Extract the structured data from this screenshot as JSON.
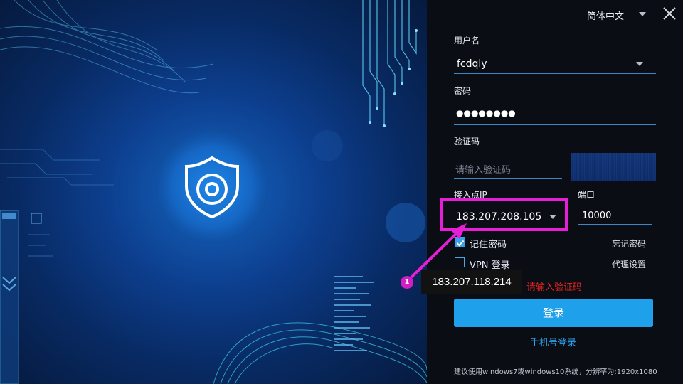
{
  "language": {
    "label": "简体中文"
  },
  "username": {
    "label": "用户名",
    "value": "fcdqly"
  },
  "password": {
    "label": "密码",
    "value": "●●●●●●●●"
  },
  "captcha": {
    "label": "验证码",
    "placeholder": "请输入验证码"
  },
  "access_point": {
    "label": "接入点IP",
    "value": "183.207.208.105"
  },
  "port": {
    "label": "端口",
    "value": "10000"
  },
  "remember_password": {
    "label": "记住密码",
    "checked": true
  },
  "forgot_password": {
    "label": "忘记密码"
  },
  "vpn_login": {
    "label": "VPN 登录",
    "checked": false
  },
  "proxy_settings": {
    "label": "代理设置"
  },
  "error": {
    "text": "请输入验证码"
  },
  "login_button": {
    "label": "登录"
  },
  "phone_login": {
    "label": "手机号登录"
  },
  "footer_note": {
    "text": "建议使用windows7或windows10系统，分辨率为:1920x1080"
  },
  "annotation": {
    "badge": "1",
    "tooltip": "183.207.118.214"
  },
  "colors": {
    "accent": "#1ea0ea",
    "highlight": "#e61fd6",
    "error": "#e8241f",
    "panel_bg": "#0a0d14"
  },
  "icons": {
    "hero": "shield-eye-icon",
    "close": "close-icon",
    "dropdown": "chevron-down-icon"
  }
}
